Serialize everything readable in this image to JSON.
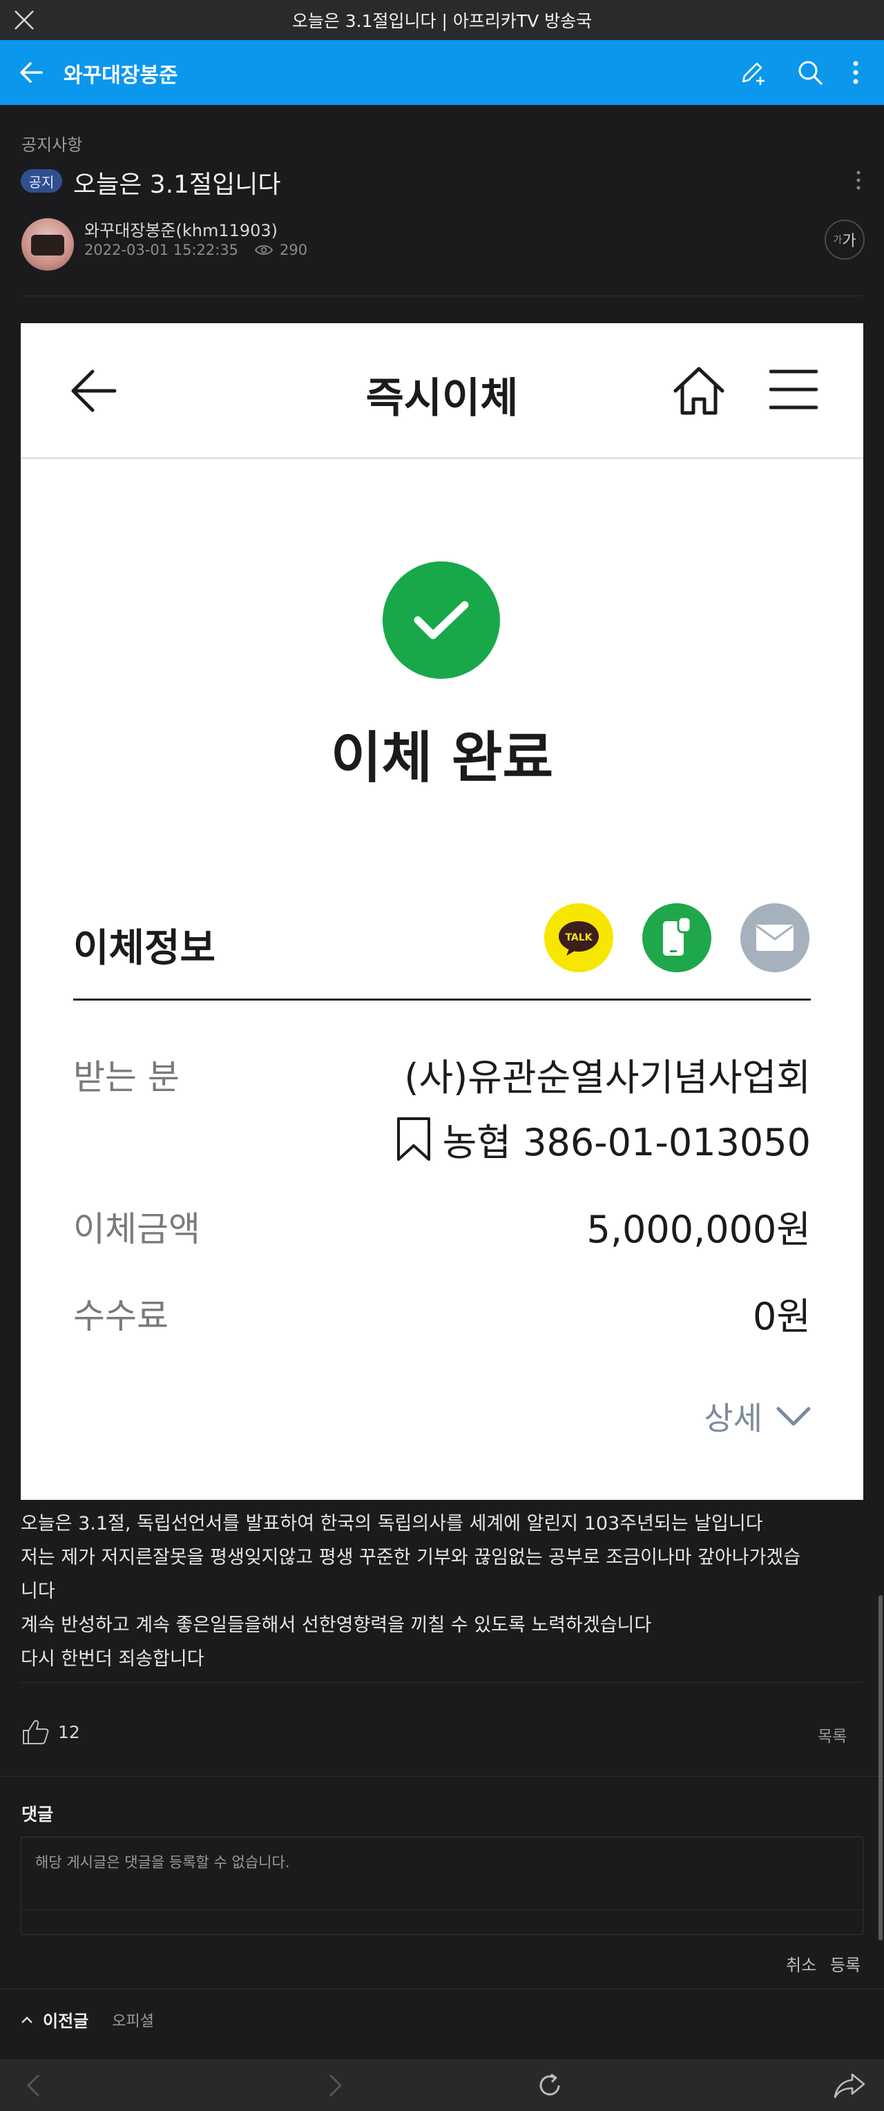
{
  "window": {
    "title": "오늘은 3.1절입니다 | 아프리카TV 방송국"
  },
  "appbar": {
    "channel_name": "와꾸대장봉준"
  },
  "post": {
    "category": "공지사항",
    "badge": "공지",
    "title": "오늘은 3.1절입니다",
    "author": "와꾸대장봉준(khm11903)",
    "datetime": "2022-03-01 15:22:35",
    "views": "290",
    "font_button": "가"
  },
  "receipt": {
    "header_title": "즉시이체",
    "status": "이체 완료",
    "info_title": "이체정보",
    "share_icons": [
      "kakaotalk-icon",
      "phone-message-icon",
      "mail-icon"
    ],
    "recipient_label": "받는 분",
    "recipient_name": "(사)유관순열사기념사업회",
    "recipient_account": "농협 386-01-013050",
    "amount_label": "이체금액",
    "amount_value": "5,000,000원",
    "fee_label": "수수료",
    "fee_value": "0원",
    "detail_label": "상세"
  },
  "body_lines": [
    "오늘은 3.1절, 독립선언서를 발표하여 한국의 독립의사를 세계에 알린지 103주년되는 날입니다",
    "저는 제가 저지른잘못을 평생잊지않고 평생 꾸준한 기부와 끊임없는 공부로 조금이나마 갚아나가겠습",
    "니다",
    "계속 반성하고 계속 좋은일들을해서 선한영향력을 끼칠 수 있도록 노력하겠습니다",
    "다시 한번더 죄송합니다"
  ],
  "actions": {
    "like_count": "12",
    "list_label": "목록"
  },
  "comments": {
    "title": "댓글",
    "placeholder": "해당 게시글은 댓글을 등록할 수 없습니다.",
    "cancel": "취소",
    "submit": "등록"
  },
  "prev_post": {
    "label": "이전글",
    "title": "오피셜"
  },
  "colors": {
    "appbar": "#0b97ec",
    "success": "#18a84a",
    "kakao": "#f7e600",
    "badge": "#2f4f8f"
  }
}
